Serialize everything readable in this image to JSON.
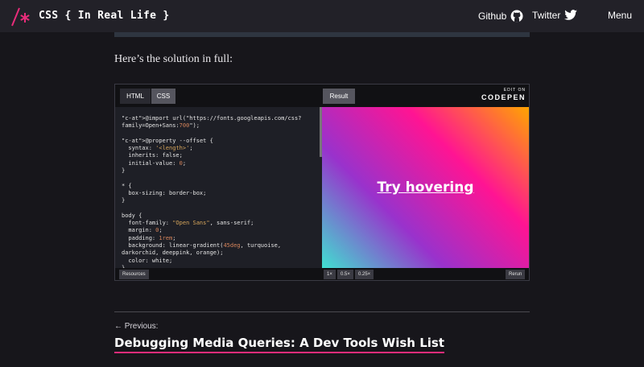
{
  "header": {
    "logo_text": "CSS { In Real Life }",
    "nav": {
      "github": "Github",
      "twitter": "Twitter",
      "menu": "Menu"
    }
  },
  "article": {
    "intro": "Here’s the solution in full:"
  },
  "embed": {
    "tabs": {
      "html": "HTML",
      "css": "CSS",
      "result": "Result"
    },
    "brand": {
      "edit_on": "EDIT ON",
      "name": "CODEPEN"
    },
    "code_lines": [
      "@import url(\"https://fonts.googleapis.com/css?",
      "family=Open+Sans:700\");",
      "",
      "@property --offset {",
      "  syntax: '<length>';",
      "  inherits: false;",
      "  initial-value: 0;",
      "}",
      "",
      "* {",
      "  box-sizing: border-box;",
      "}",
      "",
      "body {",
      "  font-family: \"Open Sans\", sans-serif;",
      "  margin: 0;",
      "  padding: 1rem;",
      "  background: linear-gradient(45deg, turquoise,",
      "darkorchid, deeppink, orange);",
      "  color: white;",
      "}"
    ],
    "result_link": "Try hovering",
    "footer": {
      "resources": "Resources",
      "zoom_1x": "1×",
      "zoom_05x": "0.5×",
      "zoom_025x": "0.25×",
      "rerun": "Rerun"
    }
  },
  "pagination": {
    "prev_label": "← Previous:",
    "prev_title": "Debugging Media Queries: A Dev Tools Wish List"
  },
  "colors": {
    "accent": "#e82c7a",
    "topbar": "#222128",
    "background": "#17161b"
  }
}
